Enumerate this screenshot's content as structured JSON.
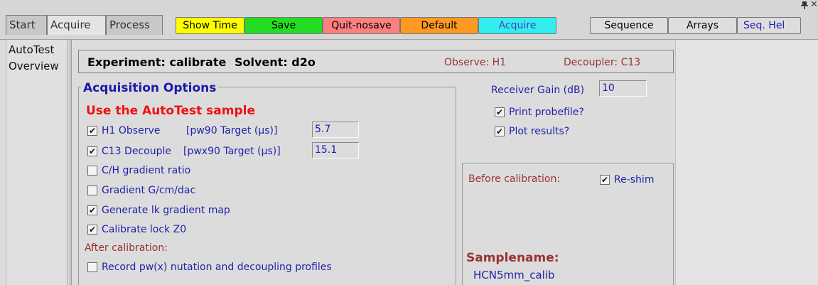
{
  "tabs": [
    {
      "label": "Start",
      "active": false
    },
    {
      "label": "Acquire",
      "active": true
    },
    {
      "label": "Process",
      "active": false
    }
  ],
  "toolbar": {
    "show_time": "Show Time",
    "save": "Save",
    "quit_nosave": "Quit-nosave",
    "default": "Default",
    "acquire": "Acquire",
    "sequence": "Sequence",
    "arrays": "Arrays",
    "seq_help": "Seq. Hel"
  },
  "toolbar_colors": {
    "show_time": "#ffff00",
    "save": "#22dd22",
    "quit_nosave": "#ff8080",
    "default": "#ff9922",
    "acquire": "#33eeee"
  },
  "sidebar": {
    "items": [
      "AutoTest",
      "Overview"
    ]
  },
  "header": {
    "experiment": "Experiment: calibrate",
    "solvent": "Solvent: d2o",
    "observe": "Observe: H1",
    "decoupler": "Decoupler: C13"
  },
  "acq": {
    "title": "Acquisition Options",
    "autotest_label": "Use the AutoTest sample",
    "h1_observe": {
      "label": "H1 Observe",
      "checked": true,
      "target_label": "[pw90 Target (µs)]",
      "value": "5.7"
    },
    "c13_decouple": {
      "label": "C13 Decouple",
      "checked": true,
      "target_label": "[pwx90 Target (µs)]",
      "value": "15.1"
    },
    "ch_ratio": {
      "label": "C/H gradient ratio",
      "checked": false
    },
    "gradient_gcm": {
      "label": "Gradient G/cm/dac",
      "checked": false
    },
    "lk_map": {
      "label": "Generate lk gradient map",
      "checked": true
    },
    "lock_z0": {
      "label": "Calibrate lock Z0",
      "checked": true
    },
    "after_cal": "After calibration:",
    "record_pw": {
      "label": "Record pw(x) nutation and decoupling profiles",
      "checked": false
    }
  },
  "right": {
    "receiver_gain_label": "Receiver Gain (dB)",
    "receiver_gain_value": "10",
    "print_probefile": {
      "label": "Print probefile?",
      "checked": true
    },
    "plot_results": {
      "label": "Plot results?",
      "checked": true
    }
  },
  "before": {
    "label": "Before calibration:",
    "reshim": {
      "label": "Re-shim",
      "checked": true
    },
    "samplename_label": "Samplename:",
    "samplename_value": "HCN5mm_calib"
  }
}
